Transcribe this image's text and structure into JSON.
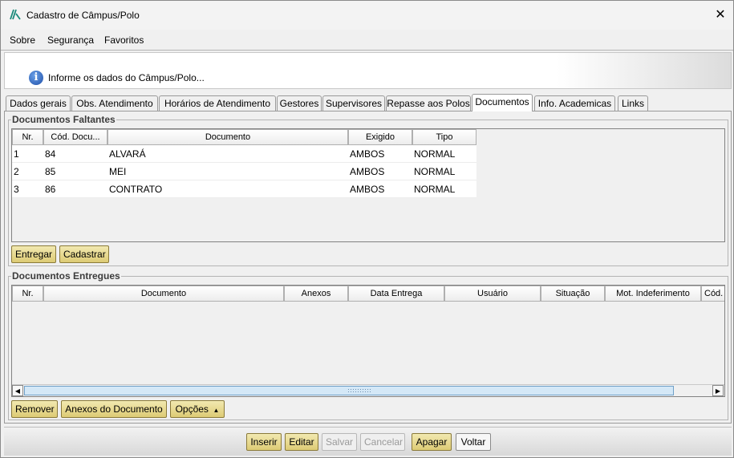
{
  "window": {
    "title": "Cadastro de Câmpus/Polo",
    "icon": "app-logo-icon",
    "close_icon": "close-icon"
  },
  "menubar": {
    "items": [
      {
        "label": "Sobre"
      },
      {
        "label": "Segurança"
      },
      {
        "label": "Favoritos"
      }
    ]
  },
  "banner": {
    "icon": "info-icon",
    "text": "Informe os dados do Câmpus/Polo..."
  },
  "tabs": [
    {
      "label": "Dados gerais"
    },
    {
      "label": "Obs. Atendimento"
    },
    {
      "label": "Horários de Atendimento"
    },
    {
      "label": "Gestores"
    },
    {
      "label": "Supervisores"
    },
    {
      "label": "Repasse aos Polos"
    },
    {
      "label": "Documentos"
    },
    {
      "label": "Info. Academicas"
    },
    {
      "label": "Links"
    }
  ],
  "active_tab": "Documentos",
  "faltantes": {
    "legend": "Documentos Faltantes",
    "columns": [
      "Nr.",
      "Cód. Docu...",
      "Documento",
      "Exigido",
      "Tipo"
    ],
    "rows": [
      [
        "1",
        "84",
        "ALVARÁ",
        "AMBOS",
        "NORMAL"
      ],
      [
        "2",
        "85",
        "MEI",
        "AMBOS",
        "NORMAL"
      ],
      [
        "3",
        "86",
        "CONTRATO",
        "AMBOS",
        "NORMAL"
      ]
    ],
    "buttons": {
      "entregar": "Entregar",
      "cadastrar": "Cadastrar"
    }
  },
  "entregues": {
    "legend": "Documentos Entregues",
    "columns": [
      "Nr.",
      "Documento",
      "Anexos",
      "Data Entrega",
      "Usuário",
      "Situação",
      "Mot. Indeferimento",
      "Cód."
    ],
    "buttons": {
      "remover": "Remover",
      "anexos": "Anexos do Documento",
      "opcoes": "Opções"
    },
    "opcoes_icon": "caret-up-icon"
  },
  "footer": {
    "inserir": "Inserir",
    "editar": "Editar",
    "salvar": "Salvar",
    "cancelar": "Cancelar",
    "apagar": "Apagar",
    "voltar": "Voltar"
  }
}
